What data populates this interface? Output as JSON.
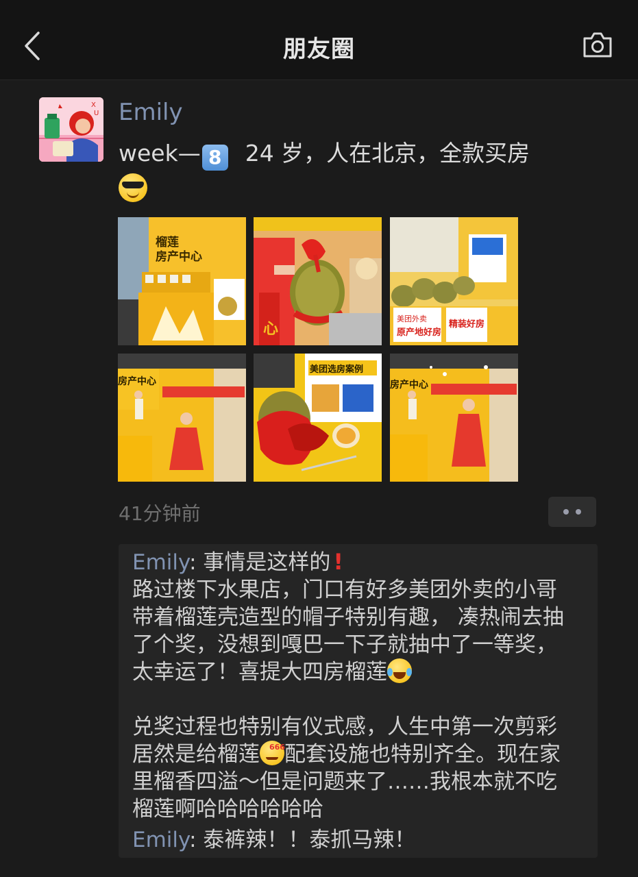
{
  "header": {
    "title": "朋友圈",
    "back_icon": "chevron-left-icon",
    "camera_icon": "camera-icon"
  },
  "post": {
    "author": "Emily",
    "text_prefix": "week—",
    "keycap": "8",
    "text_main": "24 岁，人在北京，全款买房",
    "trailing_emoji": "smiling-face-with-sunglasses",
    "photos": [
      {
        "name": "photo-durian-property-center"
      },
      {
        "name": "photo-durian-ribbon-handover"
      },
      {
        "name": "photo-durian-display-table"
      },
      {
        "name": "photo-girl-stage-1"
      },
      {
        "name": "photo-durian-red-bow"
      },
      {
        "name": "photo-girl-stage-2"
      }
    ],
    "timestamp": "41分钟前",
    "more_icon": "more-dots-icon"
  },
  "comments": [
    {
      "author": "Emily",
      "separator": ": ",
      "first_line": "事情是这样的",
      "emoji": "exclamation-mark",
      "lines": [
        "路过楼下水果店，门口有好多美团外卖的小哥",
        "带着榴莲壳造型的帽子特别有趣， 凑热闹去抽",
        "了个奖，没想到嘎巴一下子就抽中了一等奖，",
        "太幸运了！喜提大四房榴莲"
      ],
      "emoji_laugh": "face-with-tears-of-joy",
      "lines2_a": "兑奖过程也特别有仪式感，人生中第一次剪彩",
      "lines2_b_pre": "居然是给榴莲",
      "emoji_666": "666",
      "lines2_b_post": "配套设施也特别齐全。现在家",
      "lines2_c": "里榴香四溢～但是问题来了……我根本就不吃",
      "lines2_d": "榴莲啊哈哈哈哈哈哈"
    },
    {
      "author": "Emily",
      "separator": ": ",
      "text": "泰裤辣！！泰抓马辣！"
    }
  ],
  "colors": {
    "background": "#1b1b1b",
    "name_blue": "#8193b2",
    "durian_yellow": "#f5b400",
    "ribbon_red": "#d8231d"
  }
}
